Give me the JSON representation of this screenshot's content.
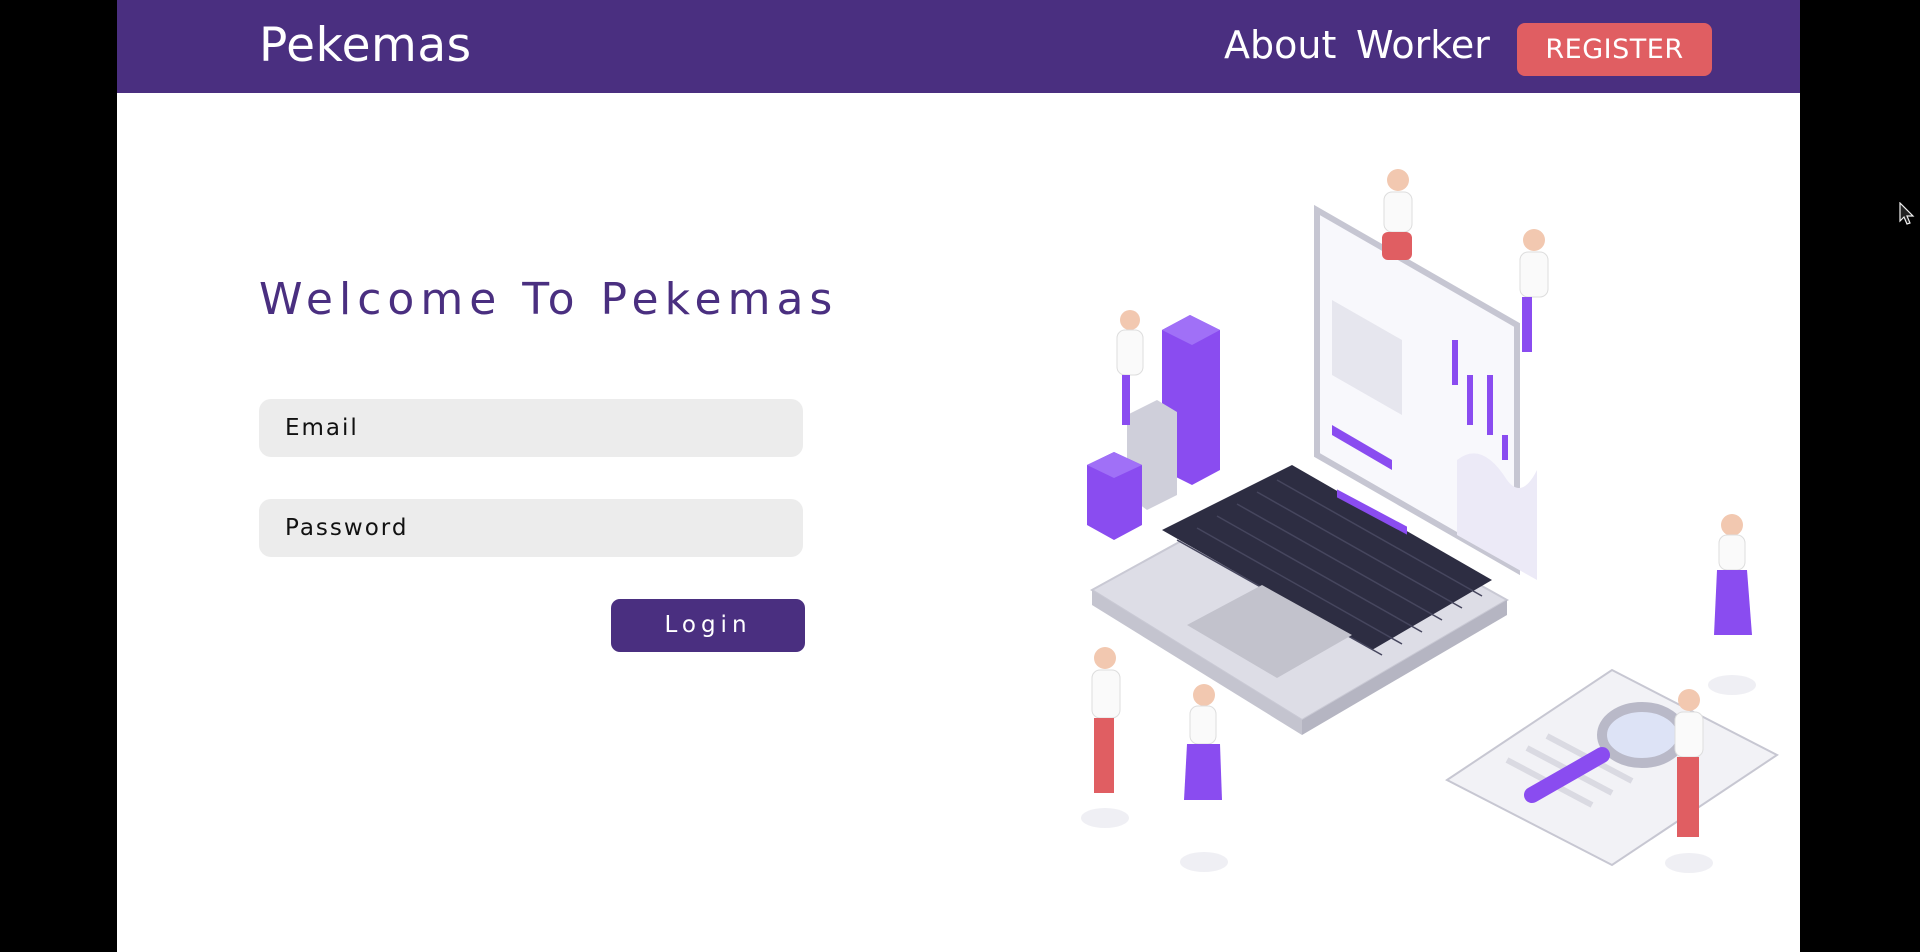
{
  "app": {
    "brand": "Pekemas"
  },
  "nav": {
    "about": "About",
    "worker": "Worker",
    "register": "REGISTER"
  },
  "login_form": {
    "title": "Welcome To Pekemas",
    "email_placeholder": "Email",
    "password_placeholder": "Password",
    "login_label": "Login"
  },
  "colors": {
    "primary": "#4a2f80",
    "accent": "#e05e62",
    "purple": "#8a4cf0",
    "field_bg": "#ececec"
  },
  "icons": {
    "illustration": "people-laptop-analytics-illustration",
    "cursor": "mouse-pointer-icon"
  }
}
